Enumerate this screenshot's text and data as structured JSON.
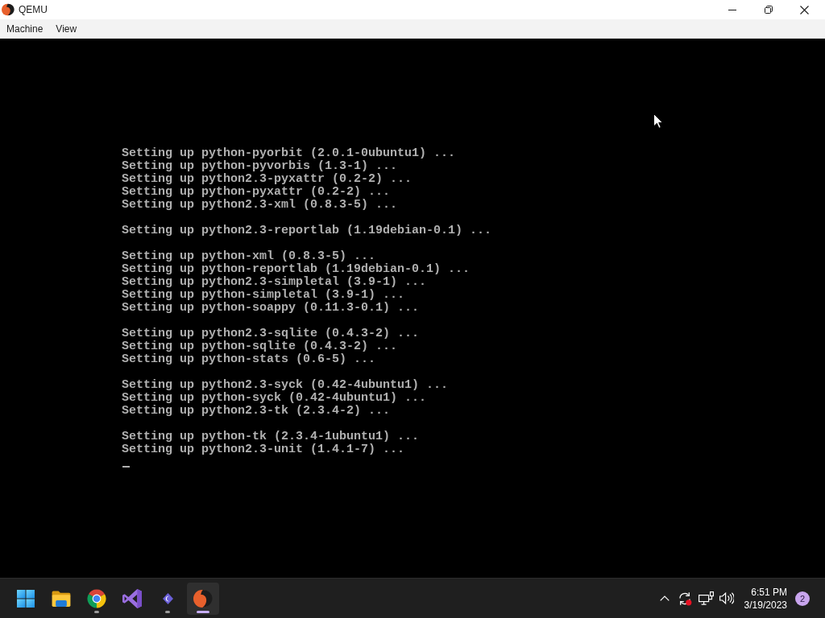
{
  "window": {
    "title": "QEMU"
  },
  "menu_bar": {
    "items": [
      "Machine",
      "View"
    ]
  },
  "console": {
    "blocks": [
      [
        "Setting up python-pyorbit (2.0.1-0ubuntu1) ...",
        "Setting up python-pyvorbis (1.3-1) ...",
        "Setting up python2.3-pyxattr (0.2-2) ...",
        "Setting up python-pyxattr (0.2-2) ...",
        "Setting up python2.3-xml (0.8.3-5) ..."
      ],
      [
        "Setting up python2.3-reportlab (1.19debian-0.1) ..."
      ],
      [
        "Setting up python-xml (0.8.3-5) ...",
        "Setting up python-reportlab (1.19debian-0.1) ...",
        "Setting up python2.3-simpletal (3.9-1) ...",
        "Setting up python-simpletal (3.9-1) ...",
        "Setting up python-soappy (0.11.3-0.1) ..."
      ],
      [
        "Setting up python2.3-sqlite (0.4.3-2) ...",
        "Setting up python-sqlite (0.4.3-2) ...",
        "Setting up python-stats (0.6-5) ..."
      ],
      [
        "Setting up python2.3-syck (0.42-4ubuntu1) ...",
        "Setting up python-syck (0.42-4ubuntu1) ...",
        "Setting up python2.3-tk (2.3.4-2) ..."
      ],
      [
        "Setting up python-tk (2.3.4-1ubuntu1) ...",
        "Setting up python2.3-unit (1.4.1-7) ..."
      ]
    ],
    "cursor": true
  },
  "taskbar": {
    "apps": [
      {
        "kind": "start",
        "running": false,
        "selected": false
      },
      {
        "kind": "explorer",
        "running": false,
        "selected": false
      },
      {
        "kind": "chrome",
        "running": true,
        "selected": false
      },
      {
        "kind": "visual-studio",
        "running": false,
        "selected": false
      },
      {
        "kind": "chat",
        "running": true,
        "selected": false
      },
      {
        "kind": "qemu",
        "running": true,
        "selected": true
      }
    ],
    "tray": {
      "time": "6:51 PM",
      "date": "3/19/2023",
      "notification_count": "2"
    }
  }
}
